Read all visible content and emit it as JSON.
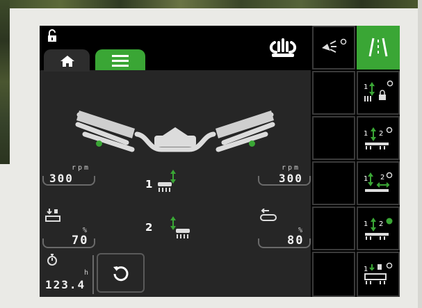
{
  "rotors": {
    "left": {
      "speed_value": "300",
      "speed_unit": "rpm",
      "percent_value": "70",
      "percent_unit": "%"
    },
    "right": {
      "speed_value": "300",
      "speed_unit": "rpm",
      "percent_value": "80",
      "percent_unit": "%"
    }
  },
  "center": {
    "rotor1_label": "1",
    "rotor2_label": "2"
  },
  "hours": {
    "value": "123.4",
    "unit": "h"
  },
  "right_column_a": [
    {
      "icon": "work-light-icon",
      "state": "off"
    },
    {
      "icon": "empty",
      "state": "none"
    },
    {
      "icon": "empty",
      "state": "none"
    },
    {
      "icon": "empty",
      "state": "none"
    },
    {
      "icon": "empty",
      "state": "none"
    },
    {
      "icon": "empty",
      "state": "none"
    }
  ],
  "right_column_b": [
    {
      "icon": "tramline-icon",
      "state": "active"
    },
    {
      "icon": "rotor1-lift-lock-icon",
      "state": "off"
    },
    {
      "icon": "rotor-1-2-lift-icon",
      "state": "off"
    },
    {
      "icon": "rotor-1-2-width-icon",
      "state": "off"
    },
    {
      "icon": "rotor-1-2-lift-active-icon",
      "state": "on"
    },
    {
      "icon": "rotor1-lower-icon",
      "state": "off"
    }
  ],
  "colors": {
    "accent": "#3aa635",
    "panel": "#262626",
    "text": "#f2f2f2"
  }
}
